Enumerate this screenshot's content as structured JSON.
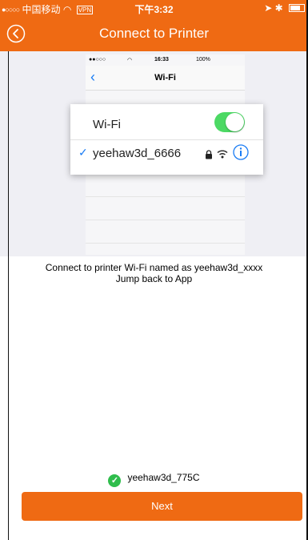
{
  "status_bar": {
    "carrier": "中国移动",
    "vpn": "VPN",
    "time": "下午3:32"
  },
  "nav": {
    "title": "Connect to Printer"
  },
  "guide_image": {
    "status_time": "16:33",
    "status_battery": "100%",
    "screen_title": "Wi-Fi",
    "wifi_label": "Wi-Fi",
    "wifi_enabled": true,
    "network_name": "yeehaw3d_6666"
  },
  "instructions": {
    "line1": "Connect  to printer Wi-Fi named as yeehaw3d_xxxx",
    "line2": "Jump back to App"
  },
  "connection": {
    "network": "yeehaw3d_775C"
  },
  "actions": {
    "next_label": "Next"
  },
  "colors": {
    "accent": "#ef6a13",
    "success": "#2fbd4c",
    "ios_blue": "#1a7cf4"
  }
}
